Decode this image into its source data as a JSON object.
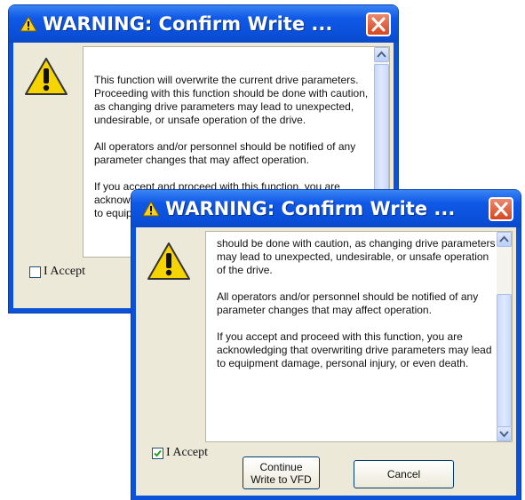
{
  "dialog_back": {
    "title": "WARNING: Confirm Write ...",
    "paragraphs": [
      "This function will overwrite the current drive parameters. Proceeding with this function should be done with caution, as changing drive parameters may lead to unexpected, undesirable, or unsafe operation of the drive.",
      "All operators and/or personnel should be notified of any parameter changes that may affect operation.",
      "If you accept and proceed with this function, you are acknowledging that overwriting drive parameters may lead to equipment damage, personal injury, or even death."
    ],
    "accept_label": "I Accept",
    "accept_checked": false
  },
  "dialog_front": {
    "title": "WARNING: Confirm Write ...",
    "paragraphs": [
      "should be done with caution, as changing drive parameters may lead to unexpected, undesirable, or unsafe operation of the drive.",
      "All operators and/or personnel should be notified of any parameter changes that may affect operation.",
      "If you accept and proceed with this function, you are acknowledging that overwriting drive parameters may lead to equipment damage, personal injury, or even death."
    ],
    "accept_label": "I Accept",
    "accept_checked": true,
    "continue_label_line1": "Continue",
    "continue_label_line2": "Write to VFD",
    "cancel_label": "Cancel"
  },
  "colors": {
    "titlebar": "#0a4fd8",
    "close_button": "#d7461f",
    "warning_yellow": "#f5d400",
    "dialog_face": "#ece9d8"
  },
  "icons": [
    "warning-triangle-icon",
    "close-icon",
    "scroll-up-arrow-icon",
    "scroll-down-arrow-icon",
    "checkmark-icon"
  ]
}
